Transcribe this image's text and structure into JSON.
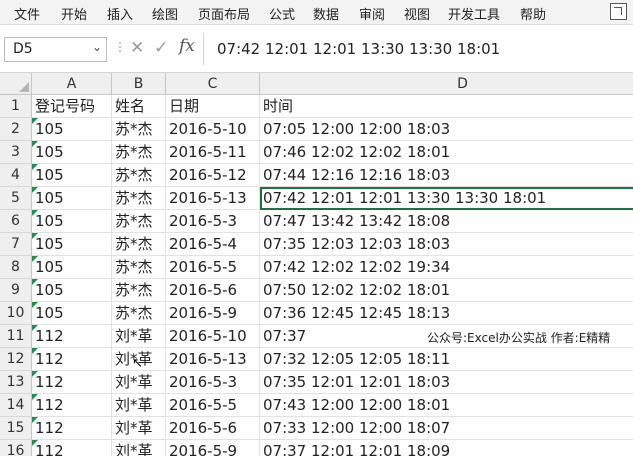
{
  "menu": {
    "items": [
      "文件",
      "开始",
      "插入",
      "绘图",
      "页面布局",
      "公式",
      "数据",
      "审阅",
      "视图",
      "开发工具",
      "帮助"
    ]
  },
  "formula_bar": {
    "name_box": "D5",
    "formula": "07:42 12:01 12:01 13:30 13:30 18:01",
    "fx_label": "fx"
  },
  "sheet": {
    "columns": [
      "A",
      "B",
      "C",
      "D"
    ],
    "rows": [
      {
        "num": "1",
        "a": "登记号码",
        "b": "姓名",
        "c": "日期",
        "d": "时间"
      },
      {
        "num": "2",
        "a": "105",
        "b": "苏*杰",
        "c": "2016-5-10",
        "d": "07:05 12:00 12:00 18:03"
      },
      {
        "num": "3",
        "a": "105",
        "b": "苏*杰",
        "c": "2016-5-11",
        "d": "07:46 12:02 12:02 18:01"
      },
      {
        "num": "4",
        "a": "105",
        "b": "苏*杰",
        "c": "2016-5-12",
        "d": "07:44 12:16 12:16 18:03"
      },
      {
        "num": "5",
        "a": "105",
        "b": "苏*杰",
        "c": "2016-5-13",
        "d": "07:42 12:01 12:01 13:30 13:30 18:01"
      },
      {
        "num": "6",
        "a": "105",
        "b": "苏*杰",
        "c": "2016-5-3",
        "d": "07:47 13:42 13:42 18:08"
      },
      {
        "num": "7",
        "a": "105",
        "b": "苏*杰",
        "c": "2016-5-4",
        "d": "07:35 12:03 12:03 18:03"
      },
      {
        "num": "8",
        "a": "105",
        "b": "苏*杰",
        "c": "2016-5-5",
        "d": "07:42 12:02 12:02 19:34"
      },
      {
        "num": "9",
        "a": "105",
        "b": "苏*杰",
        "c": "2016-5-6",
        "d": "07:50 12:02 12:02 18:01"
      },
      {
        "num": "10",
        "a": "105",
        "b": "苏*杰",
        "c": "2016-5-9",
        "d": "07:36 12:45 12:45 18:13"
      },
      {
        "num": "11",
        "a": "112",
        "b": "刘*革",
        "c": "2016-5-10",
        "d": "07:37"
      },
      {
        "num": "12",
        "a": "112",
        "b": "刘*革",
        "c": "2016-5-13",
        "d": "07:32 12:05 12:05 18:11"
      },
      {
        "num": "13",
        "a": "112",
        "b": "刘*革",
        "c": "2016-5-3",
        "d": "07:35 12:01 12:01 18:03"
      },
      {
        "num": "14",
        "a": "112",
        "b": "刘*革",
        "c": "2016-5-5",
        "d": "07:43 12:00 12:00 18:01"
      },
      {
        "num": "15",
        "a": "112",
        "b": "刘*革",
        "c": "2016-5-6",
        "d": "07:33 12:00 12:00 18:07"
      },
      {
        "num": "16",
        "a": "112",
        "b": "刘*革",
        "c": "2016-5-9",
        "d": "07:37 12:01 12:01 18:09"
      }
    ],
    "selected_cell": "D5"
  },
  "watermark": "公众号:Excel办公实战  作者:E精精",
  "colors": {
    "accent": "#1e7145",
    "error_triangle": "#1f8f4e",
    "header_bg": "#efefef"
  }
}
